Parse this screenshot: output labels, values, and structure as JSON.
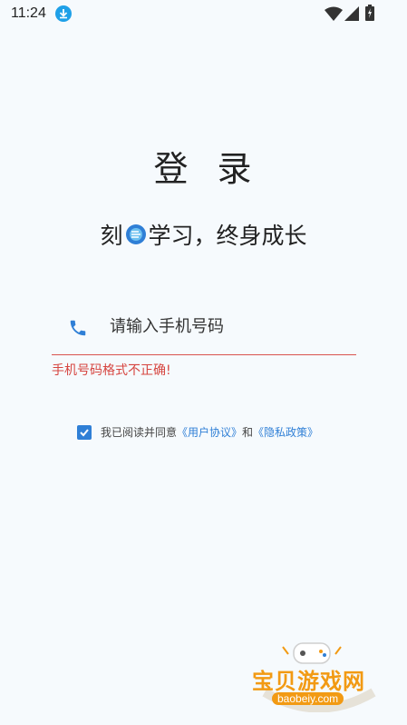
{
  "status_bar": {
    "time": "11:24",
    "icons": [
      "download-icon",
      "wifi-icon",
      "signal-icon",
      "battery-icon"
    ],
    "download_color": "#1ea0e8"
  },
  "login": {
    "title": "登 录",
    "slogan_before": "刻",
    "slogan_after": "学习，终身成长",
    "phone_placeholder": "请输入手机号码",
    "phone_value": "",
    "error_message": "手机号码格式不正确!",
    "agreement": {
      "checked": true,
      "prefix": "我已阅读并同意",
      "user_agreement": "《用户协议》",
      "and": "和",
      "privacy_policy": "《隐私政策》"
    }
  },
  "watermark": {
    "brand": "宝贝游戏网",
    "url": "baobeiy.com"
  },
  "colors": {
    "accent": "#2f7fd6",
    "error": "#d64540",
    "background": "#f6fafd"
  }
}
